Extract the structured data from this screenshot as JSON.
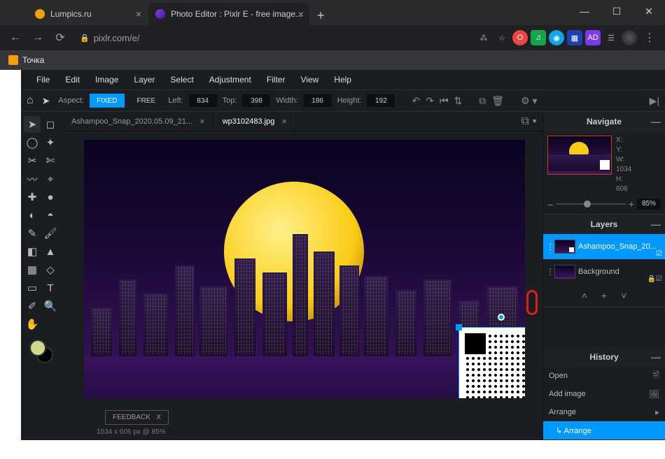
{
  "browser": {
    "tabs": [
      {
        "label": "Lumpics.ru"
      },
      {
        "label": "Photo Editor : Pixlr E - free image..."
      }
    ],
    "url": "pixlr.com/e/",
    "bookmark": "Точка"
  },
  "menu": [
    "File",
    "Edit",
    "Image",
    "Layer",
    "Select",
    "Adjustment",
    "Filter",
    "View",
    "Help"
  ],
  "options": {
    "aspect_label": "Aspect:",
    "fixed": "FIXED",
    "free": "FREE",
    "left_label": "Left:",
    "left": "834",
    "top_label": "Top:",
    "top": "398",
    "width_label": "Width:",
    "width": "186",
    "height_label": "Height:",
    "height": "192"
  },
  "docs": [
    {
      "name": "Ashampoo_Snap_2020.05.09_21..."
    },
    {
      "name": "wp3102483.jpg"
    }
  ],
  "canvas_status": "1034 x 606 px @ 85%",
  "feedback": {
    "label": "FEEDBACK",
    "close": "X"
  },
  "navigate": {
    "title": "Navigate",
    "x_label": "X:",
    "y_label": "Y:",
    "w_label": "W:",
    "h_label": "H:",
    "w": "1034",
    "h": "606",
    "zoom": "85%"
  },
  "layers": {
    "title": "Layers",
    "items": [
      {
        "name": "Ashampoo_Snap_20..."
      },
      {
        "name": "Background"
      }
    ]
  },
  "history": {
    "title": "History",
    "items": [
      {
        "label": "Open"
      },
      {
        "label": "Add image"
      },
      {
        "label": "Arrange"
      },
      {
        "label": "↳ Arrange"
      }
    ]
  }
}
